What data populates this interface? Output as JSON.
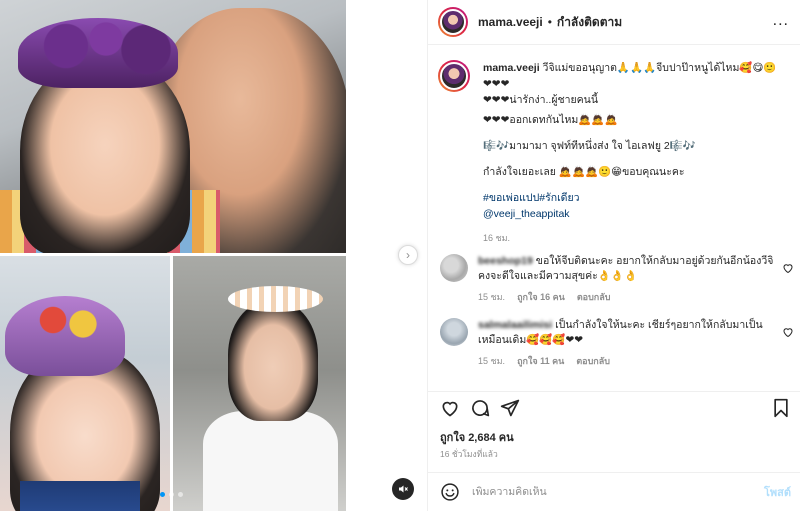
{
  "header": {
    "username": "mama.veeji",
    "separator": "•",
    "follow_status": "กำลังติดตาม",
    "more": "..."
  },
  "caption": {
    "username": "mama.veeji",
    "line1": "วีจิแม่ขออนุญาต🙏🙏🙏จีบปาป๊าหนูได้ไหม🥰😋🙂",
    "line2": "❤❤❤",
    "line3": "❤❤❤น่ารักง่า..ผู้ชายคนนี้",
    "line4": "❤❤❤ออกเดทกันไหม🙇🙇🙇",
    "line5": "🎼🎶มามามา จุฟท์ทีหนึ่งส่ง ใจ ไอเลฟยู 2🎼🎶",
    "line6": "กำลังใจเยอะเลย 🙇🙇🙇🙂😁ขอบคุณนะคะ",
    "hashtags": "#ขอเพ่อแปป#รักเดียว",
    "mention": "@veeji_theappitak",
    "time": "16 ชม."
  },
  "comments": [
    {
      "username": "beeshop19",
      "text": "ขอให้จีบติดนะคะ อยากให้กลับมาอยู่ด้วยกันอีกน้องวีจิคงจะดีใจและมีความสุขค่ะ👌👌👌",
      "time": "15 ชม.",
      "likes": "ถูกใจ 16 คน",
      "reply": "ตอบกลับ"
    },
    {
      "username": "salmalaailimisi",
      "text": "เป็นกำลังใจให้นะคะ เชียร์ๆอยากให้กลับมาเป็นเหมือนเดิม🥰🥰🥰❤❤",
      "time": "15 ชม.",
      "likes": "ถูกใจ 11 คน",
      "reply": "ตอบกลับ"
    }
  ],
  "likes_text": "ถูกใจ 2,684 คน",
  "posted_time": "16 ชั่วโมงที่แล้ว",
  "add_comment": {
    "placeholder": "เพิ่มความคิดเห็น",
    "post_label": "โพสต์"
  },
  "media": {
    "next_arrow": "›",
    "slide_count": 3,
    "active_slide": 1
  },
  "colors": {
    "accent": "#0095f6",
    "text": "#262626",
    "muted": "#8e8e8e",
    "heart": "#ed4956",
    "post_disabled": "#b2dffc"
  }
}
